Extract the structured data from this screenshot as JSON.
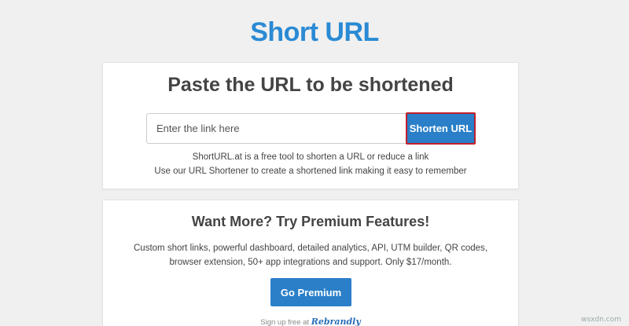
{
  "header": {
    "brand": "Short URL"
  },
  "shorten_card": {
    "title": "Paste the URL to be shortened",
    "input_placeholder": "Enter the link here",
    "button_label": "Shorten URL",
    "description_lines": [
      "ShortURL.at is a free tool to shorten a URL or reduce a link",
      "Use our URL Shortener to create a shortened link making it easy to remember"
    ]
  },
  "premium_card": {
    "title": "Want More? Try Premium Features!",
    "description_lines": [
      "Custom short links, powerful dashboard, detailed analytics, API, UTM builder, QR codes,",
      "browser extension, 50+ app integrations and support. Only $17/month."
    ],
    "button_label": "Go Premium",
    "signup_text": "Sign up free at",
    "signup_brand": "Rebrandly"
  },
  "watermark": "wsxdn.com",
  "colors": {
    "brand": "#2a8ad4",
    "button": "#2a7fc8",
    "highlight_border": "#c0202a",
    "background": "#f0f0f0"
  }
}
